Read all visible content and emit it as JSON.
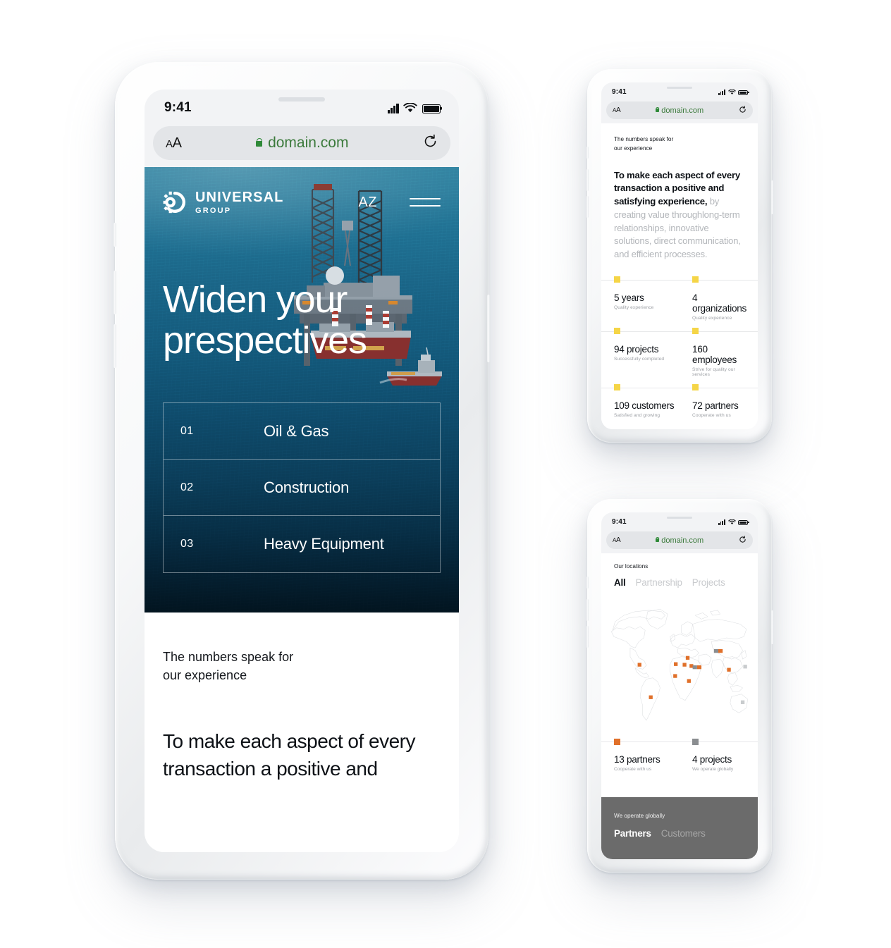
{
  "device": {
    "status_time": "9:41",
    "url": "domain.com",
    "aa_small": "A",
    "aa_large": "A",
    "reload_icon": "reload-icon",
    "lock_icon": "lock-icon"
  },
  "main_phone": {
    "nav": {
      "brand_line1": "UNIVERSAL",
      "brand_line2": "GROUP",
      "logo_icon": "gear-logo-icon",
      "language": "AZ",
      "menu_icon": "hamburger-menu-icon"
    },
    "hero": {
      "title_line1": "Widen your",
      "title_line2": "prespectives",
      "background_image": "offshore-oil-rig-photo"
    },
    "services": [
      {
        "num": "01",
        "name": "Oil & Gas"
      },
      {
        "num": "02",
        "name": "Construction"
      },
      {
        "num": "03",
        "name": "Heavy Equipment"
      }
    ],
    "white_section": {
      "kicker_line1": "The numbers speak for",
      "kicker_line2": "our experience",
      "paragraph_line1": "To make each aspect of every",
      "paragraph_line2": "transaction a positive and"
    }
  },
  "stats_phone": {
    "kicker_line1": "The numbers speak for",
    "kicker_line2": "our experience",
    "paragraph_bold": "To make each aspect of every transaction a positive and satisfying experience,",
    "paragraph_rest": " by creating value throughlong-term relationships, innovative solutions, direct communication, and efficient processes.",
    "marker_color": "#f5d547",
    "stats": [
      {
        "value": "5 years",
        "label": "Quality experience"
      },
      {
        "value": "4 organizations",
        "label": "Quality experience"
      },
      {
        "value": "94 projects",
        "label": "Successfully completed"
      },
      {
        "value": "160 employees",
        "label": "Strive for quality our services"
      },
      {
        "value": "109 customers",
        "label": "Satisfied and growing"
      },
      {
        "value": "72 partners",
        "label": "Cooperate with us"
      }
    ]
  },
  "map_phone": {
    "kicker": "Our locations",
    "tabs": [
      {
        "label": "All",
        "active": true
      },
      {
        "label": "Partnership",
        "active": false
      },
      {
        "label": "Projects",
        "active": false
      }
    ],
    "map_icon": "world-map",
    "partner_marker_color": "#e0702a",
    "project_marker_color": "#8a8d90",
    "stats": [
      {
        "value": "13 partners",
        "label": "Cooperate with us",
        "color": "#e0702a"
      },
      {
        "value": "4 projects",
        "label": "We operate globally",
        "color": "#8a8d90"
      }
    ],
    "footer": {
      "kicker": "We operate globally",
      "tabs": [
        {
          "label": "Partners",
          "active": true
        },
        {
          "label": "Customers",
          "active": false
        }
      ]
    }
  }
}
